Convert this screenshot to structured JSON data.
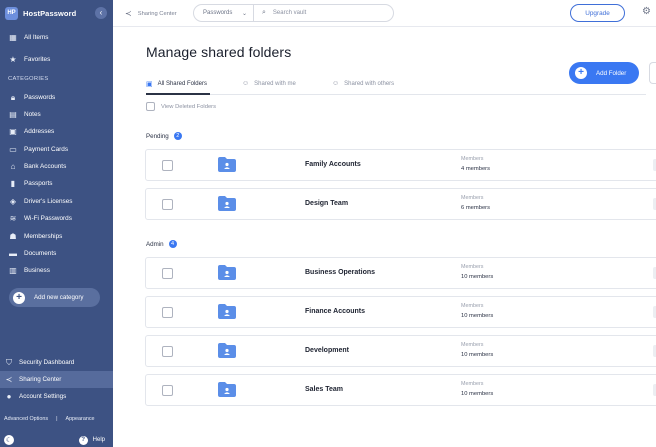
{
  "app": {
    "name": "HostPassword",
    "logo_text": "HP"
  },
  "sidebar": {
    "items": [
      {
        "icon": "grid-icon",
        "label": "All Items"
      },
      {
        "icon": "star-icon",
        "label": "Favorites"
      }
    ],
    "section_label": "CATEGORIES",
    "categories": [
      {
        "icon": "lock-icon",
        "label": "Passwords"
      },
      {
        "icon": "note-icon",
        "label": "Notes"
      },
      {
        "icon": "address-card-icon",
        "label": "Addresses"
      },
      {
        "icon": "credit-card-icon",
        "label": "Payment Cards"
      },
      {
        "icon": "bank-icon",
        "label": "Bank Accounts"
      },
      {
        "icon": "passport-icon",
        "label": "Passports"
      },
      {
        "icon": "id-card-icon",
        "label": "Driver's Licenses"
      },
      {
        "icon": "wifi-icon",
        "label": "Wi-Fi Passwords"
      },
      {
        "icon": "member-card-icon",
        "label": "Memberships"
      },
      {
        "icon": "document-icon",
        "label": "Documents"
      },
      {
        "icon": "building-icon",
        "label": "Business"
      }
    ],
    "add_category_label": "Add new category",
    "bottom": [
      {
        "icon": "shield-icon",
        "label": "Security Dashboard"
      },
      {
        "icon": "share-icon",
        "label": "Sharing Center",
        "active": true
      },
      {
        "icon": "user-icon",
        "label": "Account Settings"
      }
    ],
    "footer_links": [
      "Advanced Options",
      "|",
      "Appearance"
    ],
    "help_label": "Help"
  },
  "topbar": {
    "breadcrumb": "Sharing Center",
    "search_scope": "Passwords",
    "search_placeholder": "Search vault",
    "upgrade_label": "Upgrade"
  },
  "main": {
    "title": "Manage shared folders",
    "add_folder_label": "Add Folder",
    "tabs": [
      {
        "label": "All Shared Folders",
        "active": true
      },
      {
        "label": "Shared with me",
        "active": false
      },
      {
        "label": "Shared with others",
        "active": false
      }
    ],
    "view_deleted_label": "View Deleted Folders",
    "members_label": "Members",
    "sections": [
      {
        "label": "Pending",
        "count": "2",
        "folders": [
          {
            "name": "Family Accounts",
            "members": "4 members"
          },
          {
            "name": "Design Team",
            "members": "6 members"
          }
        ]
      },
      {
        "label": "Admin",
        "count": "4",
        "folders": [
          {
            "name": "Business Operations",
            "members": "10 members"
          },
          {
            "name": "Finance Accounts",
            "members": "10 members"
          },
          {
            "name": "Development",
            "members": "10 members"
          },
          {
            "name": "Sales Team",
            "members": "10 members"
          }
        ]
      }
    ]
  },
  "colors": {
    "sidebar_bg": "#3d5283",
    "accent": "#3a78f2",
    "folder": "#5b8ee8"
  }
}
